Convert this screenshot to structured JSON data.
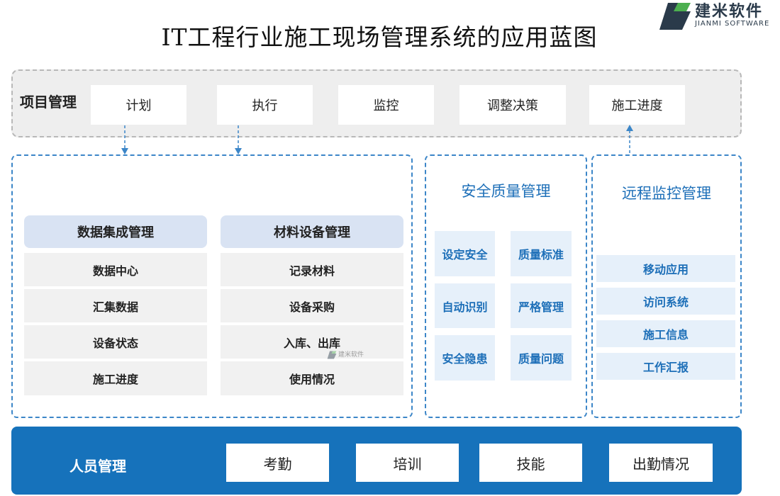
{
  "title": "IT工程行业施工现场管理系统的应用蓝图",
  "logo": {
    "name_cn": "建米软件",
    "name_en": "JIANMI SOFTWARE"
  },
  "project": {
    "label": "项目管理",
    "items": [
      "计划",
      "执行",
      "监控",
      "调整决策",
      "施工进度"
    ]
  },
  "left_panel": {
    "columns": [
      {
        "header": "数据集成管理",
        "items": [
          "数据中心",
          "汇集数据",
          "设备状态",
          "施工进度"
        ]
      },
      {
        "header": "材料设备管理",
        "items": [
          "记录材料",
          "设备采购",
          "入库、出库",
          "使用情况"
        ]
      }
    ]
  },
  "safety": {
    "title": "安全质量管理",
    "items": [
      "设定安全",
      "质量标准",
      "自动识别",
      "严格管理",
      "安全隐患",
      "质量问题"
    ]
  },
  "remote": {
    "title": "远程监控管理",
    "items": [
      "移动应用",
      "访问系统",
      "施工信息",
      "工作汇报"
    ]
  },
  "people": {
    "label": "人员管理",
    "items": [
      "考勤",
      "培训",
      "技能",
      "出勤情况"
    ]
  },
  "watermark": {
    "text": "建米软件"
  },
  "colors": {
    "blue": "#1672bb",
    "accent_text": "#1d6fb8",
    "dash": "#3c86c8",
    "header_fill": "#d9e3f3"
  }
}
